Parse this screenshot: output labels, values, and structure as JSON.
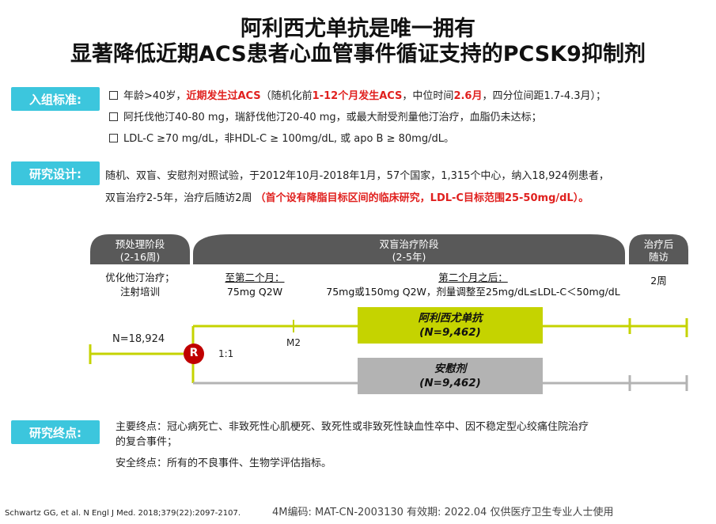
{
  "title": {
    "line1": "阿利西尤单抗是唯一拥有",
    "line2": "显著降低近期ACS患者心血管事件循证支持的PCSK9抑制剂"
  },
  "inclusion": {
    "tag": "入组标准:",
    "line1_a": "年龄>40岁，",
    "line1_b": "近期发生过ACS",
    "line1_c": "（随机化前",
    "line1_d": "1-12个月发生ACS",
    "line1_e": "，中位时间",
    "line1_f": "2.6月",
    "line1_g": "，四分位间距1.7-4.3月）；",
    "line2": "阿托伐他汀40-80 mg，瑞舒伐他汀20-40 mg，或最大耐受剂量他汀治疗，血脂仍未达标；",
    "line3": "LDL-C ≥70 mg/dL，非HDL-C ≥ 100mg/dL, 或 apo B ≥ 80mg/dL。"
  },
  "design": {
    "tag": "研究设计:",
    "line1": "随机、双盲、安慰剂对照试验，于2012年10月-2018年1月，57个国家，1,315个中心，纳入18,924例患者，",
    "line2_a": "双盲治疗2-5年，治疗后随访2周",
    "line2_b": "（首个设有降脂目标区间的临床研究，LDL-C目标范围25-50mg/dL）。"
  },
  "phases": {
    "pre": {
      "name": "预处理阶段",
      "duration": "(2-16周)"
    },
    "dbl": {
      "name": "双盲治疗阶段",
      "duration": "(2-5年)"
    },
    "post": {
      "name": "治疗后",
      "duration": "随访"
    }
  },
  "details": {
    "pre_1": "优化他汀治疗；",
    "pre_2": "注射培训",
    "m2_head": "至第二个月：",
    "m2_dose": "75mg Q2W",
    "after_head": "第二个月之后：",
    "after_dose": "75mg或150mg Q2W，剂量调整至25mg/dL≤LDL-C＜50mg/dL",
    "post_weeks": "2周"
  },
  "flow": {
    "n_total": "N=18,924",
    "randomization": "R",
    "ratio": "1:1",
    "milestone": "M2",
    "arm1_name": "阿利西尤单抗",
    "arm1_n": "(N=9,462)",
    "arm2_name": "安慰剂",
    "arm2_n": "(N=9,462)"
  },
  "endpoints": {
    "tag": "研究终点:",
    "primary": "主要终点：冠心病死亡、非致死性心肌梗死、致死性或非致死性缺血性卒中、因不稳定型心绞痛住院治疗",
    "primary_2": "的复合事件；",
    "safety": "安全终点：所有的不良事件、生物学评估指标。"
  },
  "footer": {
    "reference": "Schwartz GG, et al. N Engl J Med. 2018;379(22):2097-2107.",
    "code": "4M编码:    MAT-CN-2003130   有效期:  2022.04   仅供医疗卫生专业人士使用"
  },
  "colors": {
    "accent_tag": "#3cc6dd",
    "phase_bar": "#595959",
    "drug_arm": "#c5d300",
    "placebo_arm": "#b3b3b3",
    "randomization": "#c00000",
    "highlight_red": "#e0201e"
  }
}
